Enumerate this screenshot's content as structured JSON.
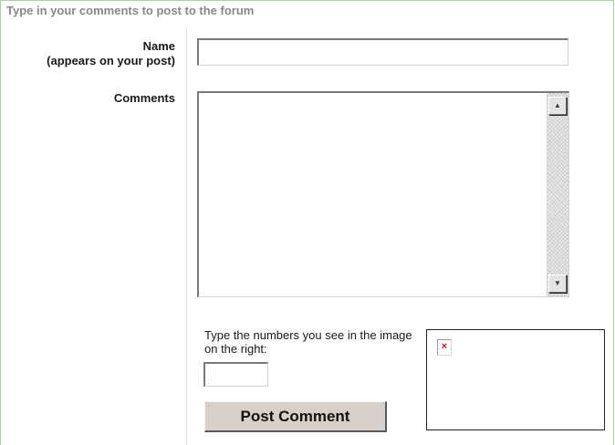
{
  "form": {
    "title": "Type in your comments to post to the forum",
    "name_label_line1": "Name",
    "name_label_line2": "(appears on your post)",
    "name_value": "",
    "comments_label": "Comments",
    "comments_value": "",
    "captcha_instructions": "Type the numbers you see in the image on the right:",
    "captcha_value": "",
    "submit_label": "Post Comment"
  },
  "icons": {
    "scroll_up": "triangle-up",
    "scroll_down": "triangle-down",
    "broken_image": "red-x"
  },
  "colors": {
    "frame_border": "#a6d5a0",
    "title_text": "#888888",
    "button_face": "#d8d0c8",
    "broken_image_x": "#e0001a"
  }
}
